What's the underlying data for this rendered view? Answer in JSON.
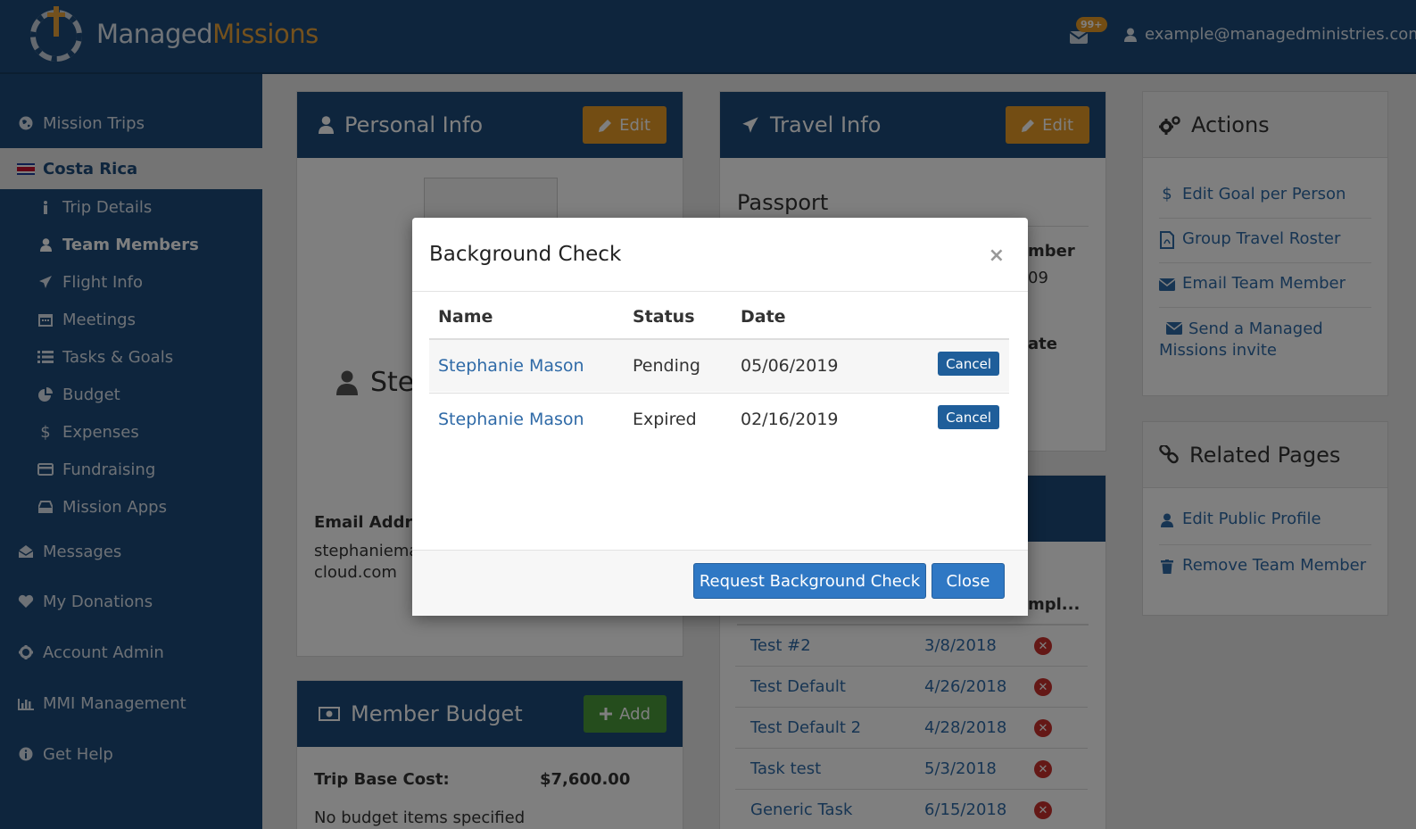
{
  "brand": {
    "name_part1": "Managed",
    "name_part2": "Missions"
  },
  "header": {
    "notification_count": "99+",
    "user_email": "example@managedministries.com"
  },
  "sidebar": {
    "mission_trips": "Mission Trips",
    "trip": "Costa Rica",
    "sub_items": [
      "Trip Details",
      "Team Members",
      "Flight Info",
      "Meetings",
      "Tasks & Goals",
      "Budget",
      "Expenses",
      "Fundraising",
      "Mission Apps"
    ],
    "messages": "Messages",
    "donations": "My Donations",
    "account_admin": "Account Admin",
    "mmi_management": "MMI Management",
    "get_help": "Get Help"
  },
  "personal_info": {
    "title": "Personal Info",
    "edit_label": "Edit",
    "name_partial": "Ste",
    "email_label": "Email Addres",
    "email_value_line1": "stephaniemas",
    "email_value_line2": "cloud.com"
  },
  "travel_info": {
    "title": "Travel Info",
    "edit_label": "Edit",
    "section": "Passport",
    "partial_label_1": "mber",
    "partial_value_1": "09",
    "partial_label_2": "ate"
  },
  "tasks": {
    "col_partial": "mpl...",
    "rows": [
      {
        "name": "Test #2",
        "date": "3/8/2018"
      },
      {
        "name": "Test Default",
        "date": "4/26/2018"
      },
      {
        "name": "Test Default 2",
        "date": "4/28/2018"
      },
      {
        "name": "Task test",
        "date": "5/3/2018"
      },
      {
        "name": "Generic Task",
        "date": "6/15/2018"
      }
    ]
  },
  "member_budget": {
    "title": "Member Budget",
    "add_label": "Add",
    "base_cost_label": "Trip Base Cost:",
    "base_cost_value": "$7,600.00",
    "empty_text": "No budget items specified"
  },
  "actions": {
    "title": "Actions",
    "items": [
      "Edit Goal per Person",
      "Group Travel Roster",
      "Email Team Member",
      "Send a Managed Missions invite"
    ]
  },
  "related_pages": {
    "title": "Related Pages",
    "items": [
      "Edit Public Profile",
      "Remove Team Member"
    ]
  },
  "modal": {
    "title": "Background Check",
    "close_x": "×",
    "headers": {
      "name": "Name",
      "status": "Status",
      "date": "Date"
    },
    "rows": [
      {
        "name": "Stephanie Mason",
        "status": "Pending",
        "date": "05/06/2019",
        "action": "Cancel"
      },
      {
        "name": "Stephanie Mason",
        "status": "Expired",
        "date": "02/16/2019",
        "action": "Cancel"
      }
    ],
    "request_label": "Request Background Check",
    "close_label": "Close"
  }
}
